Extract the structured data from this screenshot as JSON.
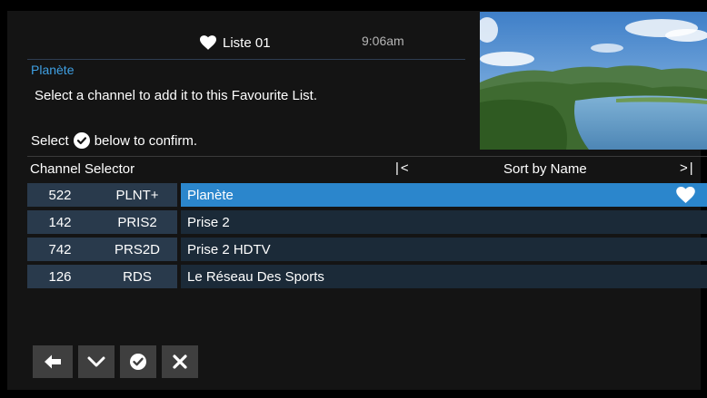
{
  "header": {
    "list_name": "Liste 01",
    "time": "9:06am"
  },
  "info": {
    "current_channel": "Planète",
    "instruction": "Select a channel to add it to this Favourite List.",
    "confirm_prefix": "Select",
    "confirm_suffix": "below to confirm."
  },
  "selector": {
    "title": "Channel Selector",
    "page_prev": "|<",
    "sort_label": "Sort by Name",
    "page_next": ">|"
  },
  "channels": [
    {
      "number": "522",
      "callsign": "PLNT+",
      "name": "Planète",
      "selected": true,
      "favourite": true
    },
    {
      "number": "142",
      "callsign": "PRIS2",
      "name": "Prise 2",
      "selected": false,
      "favourite": false
    },
    {
      "number": "742",
      "callsign": "PRS2D",
      "name": "Prise 2 HDTV",
      "selected": false,
      "favourite": false
    },
    {
      "number": "126",
      "callsign": "RDS",
      "name": "Le Réseau Des Sports",
      "selected": false,
      "favourite": false
    }
  ],
  "buttons": [
    {
      "icon": "arrow-left-icon"
    },
    {
      "icon": "chevron-down-icon"
    },
    {
      "icon": "check-circle-icon"
    },
    {
      "icon": "close-icon"
    }
  ],
  "colors": {
    "highlight": "#2b86cc",
    "row_dark": "#1b2a38",
    "number_block": "#293a4c",
    "accent_text": "#3fa0e3"
  }
}
